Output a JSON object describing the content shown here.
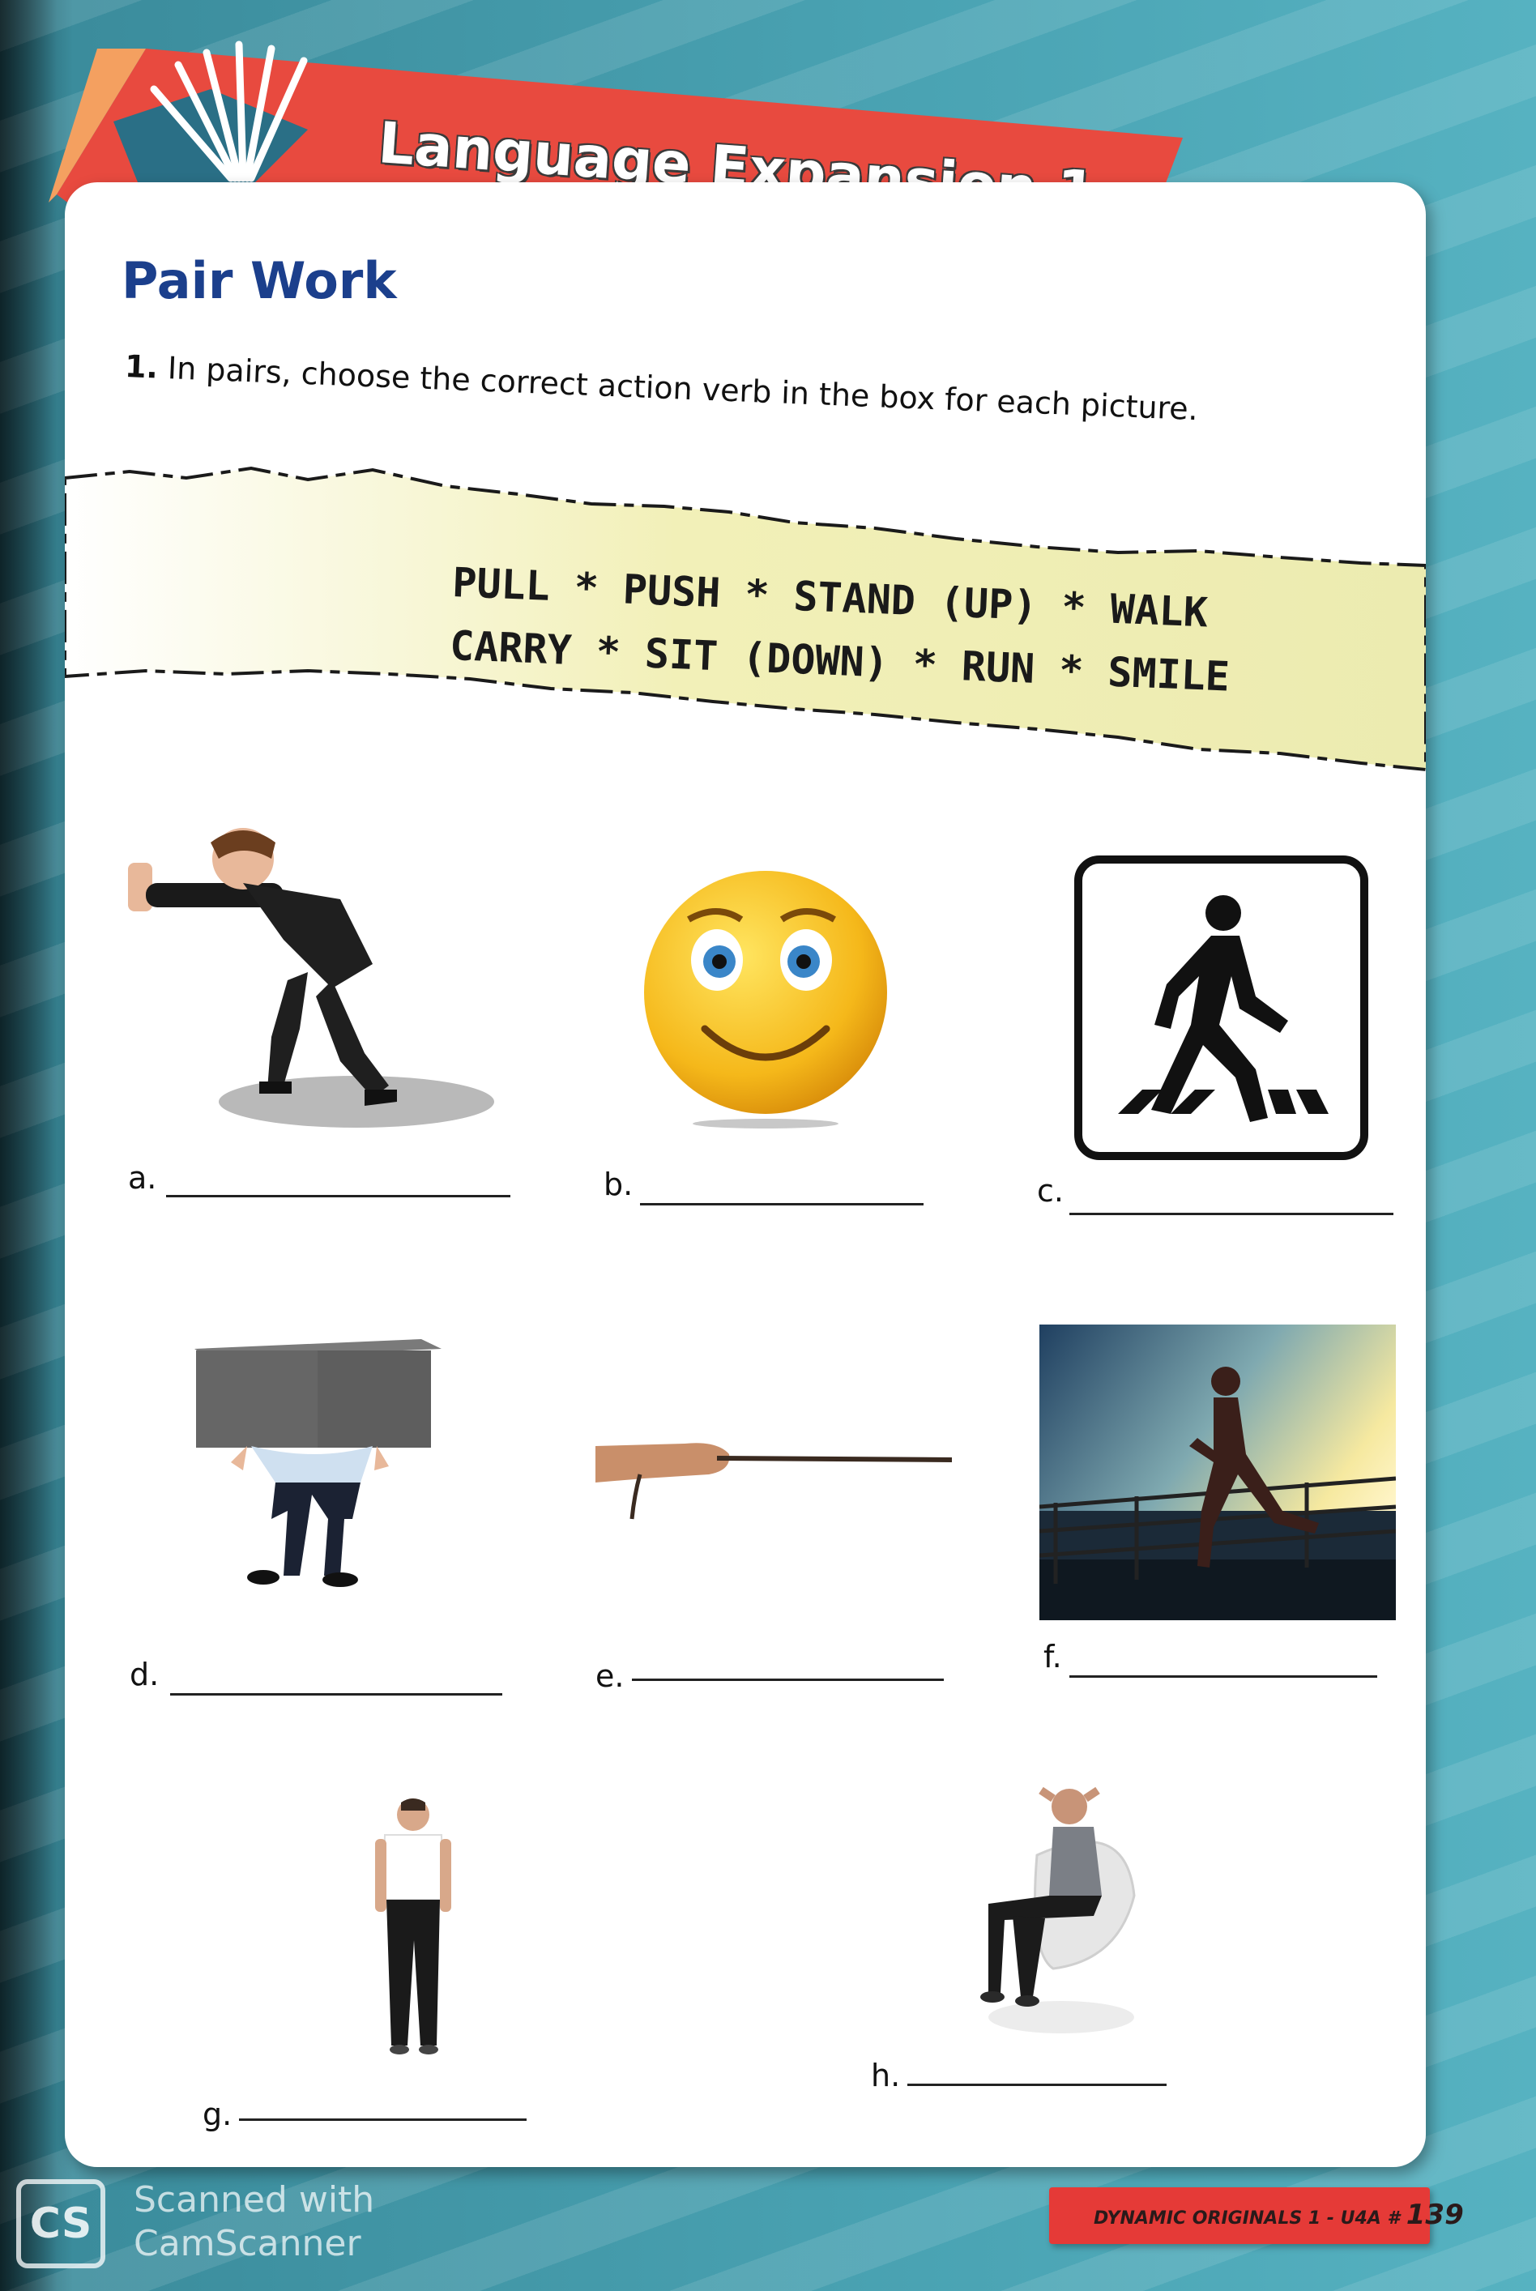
{
  "banner": {
    "title": "Language Expansion 1",
    "color": "#e84a3f"
  },
  "section": {
    "title": "Pair Work"
  },
  "instruction": {
    "number": "1.",
    "text": " In pairs, choose the correct action verb in the box for each picture."
  },
  "word_box": {
    "line1": "PULL * PUSH * STAND (UP) * WALK",
    "line2": "CARRY * SIT (DOWN) * RUN * SMILE",
    "color": "#f2f0b8"
  },
  "items": [
    {
      "label": "a.",
      "picture": "man-pushing-illustration"
    },
    {
      "label": "b.",
      "picture": "smiley-face-emoji"
    },
    {
      "label": "c.",
      "picture": "pedestrian-crossing-sign"
    },
    {
      "label": "d.",
      "picture": "man-carrying-box"
    },
    {
      "label": "e.",
      "picture": "hand-pulling-rope"
    },
    {
      "label": "f.",
      "picture": "woman-running-at-sunset"
    },
    {
      "label": "g.",
      "picture": "man-standing"
    },
    {
      "label": "h.",
      "picture": "man-sitting-in-chair"
    }
  ],
  "footer": {
    "series": "DYNAMIC ORIGINALS 1 - U4A #",
    "page": "139"
  },
  "watermark": {
    "logo": "CS",
    "line1": "Scanned with",
    "line2": "CamScanner"
  }
}
